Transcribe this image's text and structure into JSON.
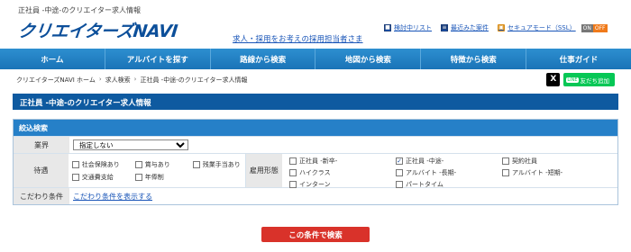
{
  "header": {
    "tagline": "正社員 -中途-のクリエイター求人情報",
    "logo": "クリエイターズNAVI",
    "recruit_link": "求人・採用をお考えの採用担当者さま",
    "links": [
      {
        "icon": "book-icon",
        "label": "検討中リスト"
      },
      {
        "icon": "list-icon",
        "label": "最近みた案件"
      },
      {
        "icon": "lock-icon",
        "label": "セキュアモード（SSL）"
      }
    ],
    "toggle": {
      "on": "ON",
      "off": "OFF"
    }
  },
  "nav": {
    "items": [
      "ホーム",
      "アルバイトを探す",
      "路線から検索",
      "地図から検索",
      "特徴から検索",
      "仕事ガイド"
    ]
  },
  "breadcrumb": [
    "クリエイターズNAVI ホーム",
    "求人検索",
    "正社員 -中途-のクリエイター求人情報"
  ],
  "social": {
    "x": "X",
    "line_label": "友だち追加",
    "line_icon": "LINE"
  },
  "page_title": "正社員 -中途-のクリエイター求人情報",
  "filter": {
    "title": "絞込検索",
    "industry": {
      "label": "業界",
      "value": "指定しない"
    },
    "benefits": {
      "label": "待遇",
      "options": [
        {
          "label": "社会保険あり",
          "checked": false
        },
        {
          "label": "賞与あり",
          "checked": false
        },
        {
          "label": "残業手当あり",
          "checked": false
        },
        {
          "label": "交通費支給",
          "checked": false
        },
        {
          "label": "年俸制",
          "checked": false
        }
      ]
    },
    "employment": {
      "label": "雇用形態",
      "options": [
        {
          "label": "正社員 -新卒-",
          "checked": false
        },
        {
          "label": "正社員 -中途-",
          "checked": true
        },
        {
          "label": "契約社員",
          "checked": false
        },
        {
          "label": "ハイクラス",
          "checked": false
        },
        {
          "label": "アルバイト -長期-",
          "checked": false
        },
        {
          "label": "アルバイト -短期-",
          "checked": false
        },
        {
          "label": "インターン",
          "checked": false
        },
        {
          "label": "パートタイム",
          "checked": false
        }
      ]
    },
    "kodawari": {
      "label": "こだわり条件",
      "link": "こだわり条件を表示する"
    }
  },
  "search_button": "この条件で検索"
}
